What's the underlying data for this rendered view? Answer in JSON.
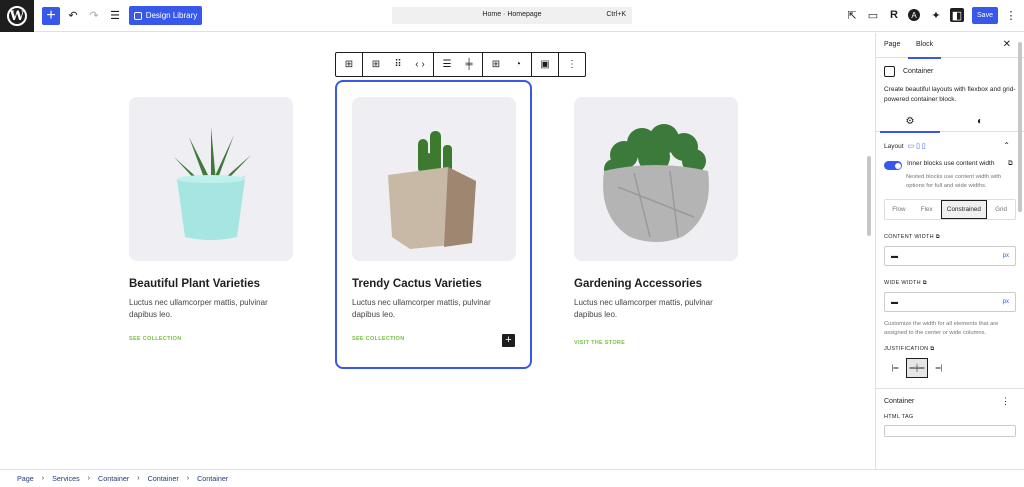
{
  "topbar": {
    "design_library_label": "Design Library",
    "command_title": "Home · Homepage",
    "command_shortcut": "Ctrl+K",
    "save_label": "Save"
  },
  "cards": [
    {
      "title": "Beautiful Plant Varieties",
      "text": "Luctus nec ullamcorper mattis, pulvinar dapibus leo.",
      "link": "SEE COLLECTION"
    },
    {
      "title": "Trendy Cactus Varieties",
      "text": "Luctus nec ullamcorper mattis, pulvinar dapibus leo.",
      "link": "SEE COLLECTION"
    },
    {
      "title": "Gardening Accessories",
      "text": "Luctus nec ullamcorper mattis, pulvinar dapibus leo.",
      "link": "VISIT THE STORE"
    }
  ],
  "sidebar": {
    "tabs": [
      "Page",
      "Block"
    ],
    "block_name": "Container",
    "block_description": "Create beautiful layouts with flexbox and grid-powered container block.",
    "layout_label": "Layout",
    "toggle_label": "Inner blocks use content width",
    "toggle_help": "Nested blocks use content width with options for full and wide widths.",
    "layout_options": [
      "Flow",
      "Flex",
      "Constrained",
      "Grid"
    ],
    "content_width_label": "CONTENT WIDTH",
    "content_width_unit": "px",
    "wide_width_label": "WIDE WIDTH",
    "wide_width_unit": "px",
    "width_help": "Customize the width for all elements that are assigned to the center or wide columns.",
    "justification_label": "JUSTIFICATION",
    "container_section": "Container",
    "html_tag_label": "HTML TAG"
  },
  "breadcrumb": [
    "Page",
    "Services",
    "Container",
    "Container",
    "Container"
  ],
  "colors": {
    "accent": "#3858e9",
    "link_green": "#7ac043",
    "card_bg": "#efeef2"
  }
}
